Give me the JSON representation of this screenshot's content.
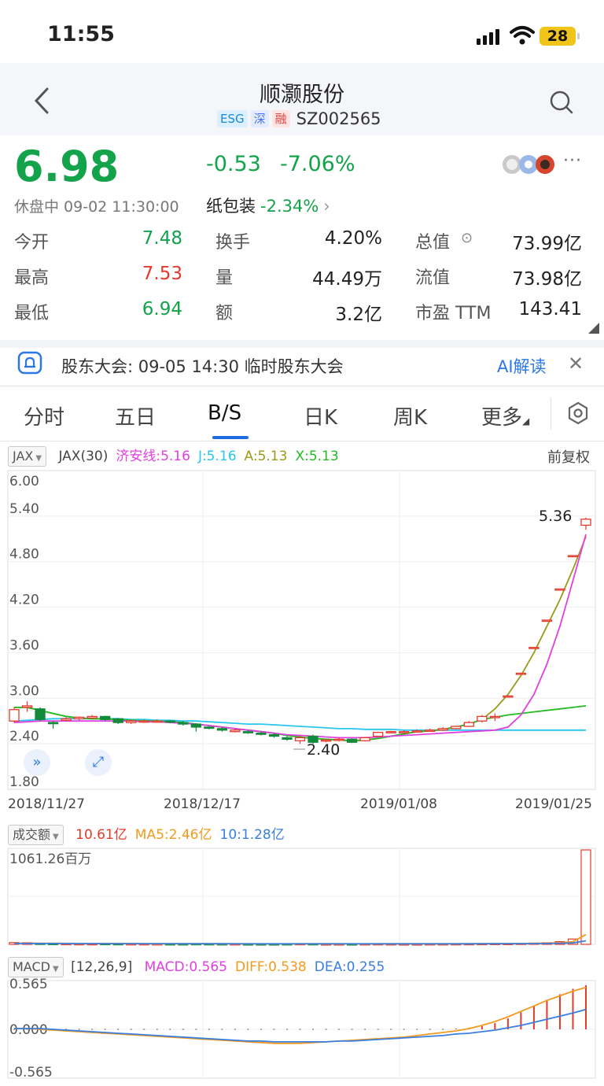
{
  "status_bar": {
    "time": "11:55",
    "battery": "28"
  },
  "header": {
    "title": "顺灏股份",
    "tags": [
      "ESG",
      "深",
      "融"
    ],
    "code": "SZ002565"
  },
  "quote": {
    "price": "6.98",
    "change": "-0.53",
    "change_pct": "-7.06%",
    "state_time": "休盘中 09-02 11:30:00",
    "sector_name": "纸包装",
    "sector_pct": "-2.34%",
    "more": "···"
  },
  "stats": [
    {
      "label": "今开",
      "value": "7.48",
      "color": "green"
    },
    {
      "label": "换手",
      "value": "4.20%",
      "color": "dark"
    },
    {
      "label": "总值",
      "value": "73.99亿",
      "color": "dark"
    },
    {
      "label": "最高",
      "value": "7.53",
      "color": "red"
    },
    {
      "label": "量",
      "value": "44.49万",
      "color": "dark"
    },
    {
      "label": "流值",
      "value": "73.98亿",
      "color": "dark"
    },
    {
      "label": "最低",
      "value": "6.94",
      "color": "green"
    },
    {
      "label": "额",
      "value": "3.2亿",
      "color": "dark"
    },
    {
      "label": "市盈 TTM",
      "value": "143.41",
      "color": "dark"
    }
  ],
  "notice": {
    "text": "股东大会: 09-05 14:30 临时股东大会",
    "ai": "AI解读",
    "close": "✕"
  },
  "tabs": [
    "分时",
    "五日",
    "B/S",
    "日K",
    "周K",
    "更多"
  ],
  "active_tab": "B/S",
  "main_chart": {
    "indicator": "JAX",
    "legend": [
      {
        "text": "JAX(30)",
        "color": "#444444"
      },
      {
        "text": "济安线:5.16",
        "color": "#e040e0"
      },
      {
        "text": "J:5.16",
        "color": "#29c6f0"
      },
      {
        "text": "A:5.13",
        "color": "#9a9a1a"
      },
      {
        "text": "X:5.13",
        "color": "#22bb22"
      }
    ],
    "adjust": "前复权",
    "y_ticks": [
      "6.00",
      "5.40",
      "4.80",
      "4.20",
      "3.60",
      "3.00",
      "2.40",
      "1.80"
    ],
    "high_label": "5.36",
    "low_label": "2.40",
    "dates": [
      "2018/11/27",
      "2018/12/17",
      "2019/01/08",
      "2019/01/25"
    ]
  },
  "volume_chart": {
    "indicator": "成交额",
    "legend": [
      {
        "text": "10.61亿",
        "color": "#e33a2c"
      },
      {
        "text": "MA5:2.46亿",
        "color": "#f39a1e"
      },
      {
        "text": "10:1.28亿",
        "color": "#3a7ee0"
      }
    ],
    "max_label": "1061.26百万"
  },
  "macd_chart": {
    "indicator": "MACD",
    "params": "[12,26,9]",
    "legend": [
      {
        "text": "MACD:0.565",
        "color": "#e040e0"
      },
      {
        "text": "DIFF:0.538",
        "color": "#f39a1e"
      },
      {
        "text": "DEA:0.255",
        "color": "#3a7ee0"
      }
    ],
    "ticks": [
      "0.565",
      "0.000",
      "-0.565"
    ]
  },
  "chart_data": {
    "type": "candlestick",
    "y_range": [
      1.8,
      6.0
    ],
    "candles": [
      {
        "o": 2.7,
        "c": 2.85,
        "h": 2.88,
        "l": 2.68
      },
      {
        "o": 2.88,
        "c": 2.9,
        "h": 2.96,
        "l": 2.82
      },
      {
        "o": 2.86,
        "c": 2.72,
        "h": 2.88,
        "l": 2.7
      },
      {
        "o": 2.68,
        "c": 2.67,
        "h": 2.7,
        "l": 2.6
      },
      {
        "o": 2.71,
        "c": 2.73,
        "h": 2.75,
        "l": 2.7
      },
      {
        "o": 2.73,
        "c": 2.75,
        "h": 2.76,
        "l": 2.71
      },
      {
        "o": 2.74,
        "c": 2.76,
        "h": 2.78,
        "l": 2.73
      },
      {
        "o": 2.76,
        "c": 2.72,
        "h": 2.77,
        "l": 2.7
      },
      {
        "o": 2.73,
        "c": 2.68,
        "h": 2.74,
        "l": 2.66
      },
      {
        "o": 2.68,
        "c": 2.7,
        "h": 2.72,
        "l": 2.66
      },
      {
        "o": 2.7,
        "c": 2.7,
        "h": 2.72,
        "l": 2.68
      },
      {
        "o": 2.69,
        "c": 2.7,
        "h": 2.72,
        "l": 2.68
      },
      {
        "o": 2.7,
        "c": 2.69,
        "h": 2.71,
        "l": 2.67
      },
      {
        "o": 2.68,
        "c": 2.66,
        "h": 2.7,
        "l": 2.64
      },
      {
        "o": 2.66,
        "c": 2.62,
        "h": 2.67,
        "l": 2.56
      },
      {
        "o": 2.62,
        "c": 2.61,
        "h": 2.63,
        "l": 2.59
      },
      {
        "o": 2.6,
        "c": 2.58,
        "h": 2.62,
        "l": 2.56
      },
      {
        "o": 2.56,
        "c": 2.58,
        "h": 2.6,
        "l": 2.55
      },
      {
        "o": 2.56,
        "c": 2.55,
        "h": 2.58,
        "l": 2.53
      },
      {
        "o": 2.54,
        "c": 2.53,
        "h": 2.56,
        "l": 2.51
      },
      {
        "o": 2.52,
        "c": 2.5,
        "h": 2.54,
        "l": 2.48
      },
      {
        "o": 2.48,
        "c": 2.46,
        "h": 2.5,
        "l": 2.44
      },
      {
        "o": 2.44,
        "c": 2.48,
        "h": 2.5,
        "l": 2.4
      },
      {
        "o": 2.5,
        "c": 2.42,
        "h": 2.52,
        "l": 2.4
      },
      {
        "o": 2.44,
        "c": 2.45,
        "h": 2.46,
        "l": 2.42
      },
      {
        "o": 2.45,
        "c": 2.46,
        "h": 2.48,
        "l": 2.43
      },
      {
        "o": 2.46,
        "c": 2.42,
        "h": 2.47,
        "l": 2.41
      },
      {
        "o": 2.44,
        "c": 2.48,
        "h": 2.49,
        "l": 2.43
      },
      {
        "o": 2.5,
        "c": 2.55,
        "h": 2.56,
        "l": 2.49
      },
      {
        "o": 2.55,
        "c": 2.56,
        "h": 2.57,
        "l": 2.54
      },
      {
        "o": 2.56,
        "c": 2.56,
        "h": 2.58,
        "l": 2.55
      },
      {
        "o": 2.56,
        "c": 2.57,
        "h": 2.59,
        "l": 2.55
      },
      {
        "o": 2.57,
        "c": 2.58,
        "h": 2.6,
        "l": 2.56
      },
      {
        "o": 2.58,
        "c": 2.6,
        "h": 2.62,
        "l": 2.57
      },
      {
        "o": 2.6,
        "c": 2.63,
        "h": 2.64,
        "l": 2.59
      },
      {
        "o": 2.63,
        "c": 2.68,
        "h": 2.7,
        "l": 2.62
      },
      {
        "o": 2.7,
        "c": 2.76,
        "h": 2.78,
        "l": 2.68
      },
      {
        "o": 2.76,
        "c": 2.76,
        "h": 2.8,
        "l": 2.7
      },
      {
        "o": 3.02,
        "c": 3.03,
        "h": 3.03,
        "l": 3.02
      },
      {
        "o": 3.32,
        "c": 3.33,
        "h": 3.33,
        "l": 3.32
      },
      {
        "o": 3.66,
        "c": 3.67,
        "h": 3.67,
        "l": 3.66
      },
      {
        "o": 4.02,
        "c": 4.03,
        "h": 4.03,
        "l": 4.02
      },
      {
        "o": 4.43,
        "c": 4.44,
        "h": 4.44,
        "l": 4.43
      },
      {
        "o": 4.87,
        "c": 4.88,
        "h": 4.88,
        "l": 4.87
      },
      {
        "o": 5.28,
        "c": 5.36,
        "h": 5.38,
        "l": 5.22
      }
    ],
    "series": [
      {
        "name": "J",
        "values": [
          2.7,
          2.71,
          2.72,
          2.73,
          2.73,
          2.73,
          2.73,
          2.73,
          2.73,
          2.72,
          2.72,
          2.71,
          2.71,
          2.7,
          2.7,
          2.69,
          2.68,
          2.67,
          2.66,
          2.66,
          2.65,
          2.64,
          2.63,
          2.62,
          2.61,
          2.6,
          2.6,
          2.59,
          2.59,
          2.59,
          2.58,
          2.58,
          2.58,
          2.58,
          2.58,
          2.58,
          2.58,
          2.58,
          2.58,
          2.58,
          2.58,
          2.58,
          2.58,
          2.58,
          2.58
        ]
      },
      {
        "name": "A",
        "values": [
          2.88,
          2.88,
          2.84,
          2.8,
          2.76,
          2.74,
          2.73,
          2.73,
          2.72,
          2.71,
          2.7,
          2.7,
          2.69,
          2.68,
          2.66,
          2.64,
          2.62,
          2.6,
          2.58,
          2.56,
          2.54,
          2.51,
          2.49,
          2.47,
          2.46,
          2.45,
          2.44,
          2.45,
          2.47,
          2.5,
          2.53,
          2.56,
          2.57,
          2.59,
          2.62,
          2.66,
          2.72,
          2.86,
          3.05,
          3.3,
          3.6,
          3.95,
          4.3,
          4.7,
          5.13
        ]
      },
      {
        "name": "X",
        "values": [
          2.88,
          2.88,
          2.84,
          2.8,
          2.76,
          2.74,
          2.73,
          2.73,
          2.72,
          2.71,
          2.7,
          2.7,
          2.69,
          2.68,
          2.66,
          2.64,
          2.62,
          2.6,
          2.58,
          2.56,
          2.54,
          2.51,
          2.49,
          2.47,
          2.46,
          2.45,
          2.44,
          2.45,
          2.47,
          2.5,
          2.53,
          2.56,
          2.57,
          2.59,
          2.62,
          2.66,
          2.72,
          2.75,
          2.78,
          2.8,
          2.82,
          2.84,
          2.86,
          2.88,
          2.9
        ]
      },
      {
        "name": "济安线",
        "values": [
          2.68,
          2.69,
          2.7,
          2.7,
          2.7,
          2.7,
          2.7,
          2.7,
          2.7,
          2.7,
          2.69,
          2.69,
          2.68,
          2.67,
          2.66,
          2.64,
          2.62,
          2.6,
          2.58,
          2.56,
          2.54,
          2.52,
          2.51,
          2.5,
          2.49,
          2.48,
          2.48,
          2.48,
          2.49,
          2.5,
          2.51,
          2.52,
          2.53,
          2.54,
          2.55,
          2.56,
          2.57,
          2.58,
          2.62,
          2.78,
          3.05,
          3.45,
          3.95,
          4.55,
          5.16
        ]
      }
    ],
    "volume_values": [
      20,
      18,
      12,
      10,
      9,
      8,
      8,
      9,
      8,
      7,
      7,
      6,
      6,
      6,
      8,
      7,
      6,
      6,
      5,
      5,
      5,
      6,
      8,
      7,
      5,
      5,
      5,
      6,
      7,
      6,
      5,
      5,
      6,
      6,
      7,
      8,
      9,
      10,
      10,
      12,
      14,
      18,
      30,
      60,
      1061.26
    ],
    "volume_ma5": [
      12,
      12,
      12,
      12,
      11,
      10,
      9,
      9,
      9,
      8,
      8,
      7,
      7,
      7,
      7,
      7,
      6,
      6,
      6,
      5,
      5,
      5,
      6,
      6,
      6,
      6,
      5,
      5,
      6,
      6,
      6,
      6,
      6,
      6,
      6,
      7,
      7,
      8,
      9,
      10,
      11,
      14,
      18,
      30,
      110
    ],
    "volume_ma10": [
      10,
      10,
      10,
      10,
      10,
      10,
      9,
      9,
      9,
      9,
      8,
      8,
      8,
      7,
      7,
      7,
      7,
      6,
      6,
      6,
      6,
      6,
      6,
      6,
      6,
      6,
      6,
      6,
      6,
      6,
      6,
      6,
      6,
      6,
      6,
      6,
      7,
      7,
      8,
      8,
      9,
      10,
      12,
      16,
      40
    ],
    "macd_bars": [
      0,
      0,
      0,
      0,
      0,
      0,
      0,
      0,
      0,
      0,
      0,
      0,
      0,
      0,
      0,
      0,
      0,
      0,
      0,
      0,
      0,
      0,
      0,
      0,
      0,
      0,
      0,
      0,
      0,
      0,
      0,
      0,
      0,
      0,
      0.01,
      0.02,
      0.04,
      0.08,
      0.14,
      0.22,
      0.3,
      0.38,
      0.45,
      0.52,
      0.565
    ],
    "macd_diff": [
      0.01,
      0.01,
      0.0,
      -0.01,
      -0.02,
      -0.03,
      -0.04,
      -0.05,
      -0.06,
      -0.07,
      -0.08,
      -0.09,
      -0.1,
      -0.11,
      -0.12,
      -0.13,
      -0.14,
      -0.15,
      -0.16,
      -0.17,
      -0.18,
      -0.18,
      -0.18,
      -0.17,
      -0.16,
      -0.15,
      -0.14,
      -0.13,
      -0.12,
      -0.11,
      -0.1,
      -0.08,
      -0.06,
      -0.04,
      -0.02,
      0.01,
      0.05,
      0.1,
      0.16,
      0.23,
      0.3,
      0.37,
      0.43,
      0.49,
      0.538
    ],
    "macd_dea": [
      0.01,
      0.01,
      0.01,
      0.0,
      -0.01,
      -0.02,
      -0.03,
      -0.04,
      -0.05,
      -0.06,
      -0.07,
      -0.08,
      -0.09,
      -0.1,
      -0.11,
      -0.12,
      -0.13,
      -0.14,
      -0.15,
      -0.15,
      -0.16,
      -0.16,
      -0.16,
      -0.16,
      -0.16,
      -0.15,
      -0.15,
      -0.14,
      -0.13,
      -0.12,
      -0.11,
      -0.1,
      -0.09,
      -0.08,
      -0.06,
      -0.05,
      -0.03,
      -0.01,
      0.02,
      0.05,
      0.09,
      0.13,
      0.17,
      0.21,
      0.255
    ]
  }
}
